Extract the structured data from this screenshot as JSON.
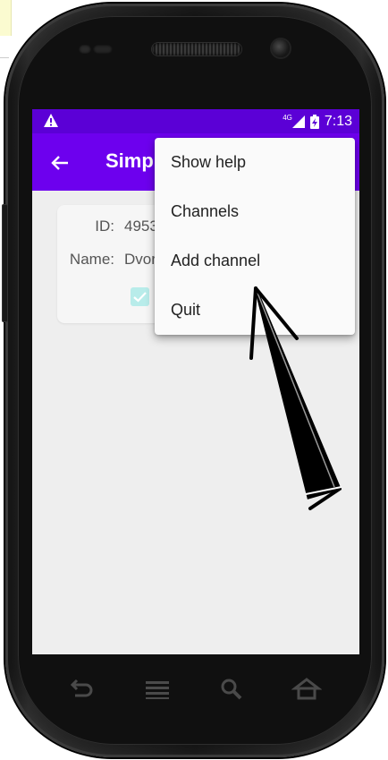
{
  "status_bar": {
    "network_type": "4G",
    "time": "7:13"
  },
  "app_bar": {
    "title": "Simpl"
  },
  "card": {
    "id_label": "ID:",
    "id_value": "4953",
    "name_label": "Name:",
    "name_value": "Dvor",
    "checkbox_checked": true
  },
  "menu": {
    "items": [
      {
        "label": "Show help"
      },
      {
        "label": "Channels"
      },
      {
        "label": "Add channel"
      },
      {
        "label": "Quit"
      }
    ]
  },
  "colors": {
    "status_bar": "#5b00d6",
    "app_bar": "#6d00ee",
    "checkbox": "#b8ecea",
    "screen_bg": "#eeeeee"
  },
  "icons": {
    "status_left": "warning-icon",
    "signal": "cell-signal-icon",
    "battery": "battery-charging-icon",
    "nav": [
      "back-icon",
      "menu-icon",
      "search-icon",
      "home-icon"
    ]
  }
}
